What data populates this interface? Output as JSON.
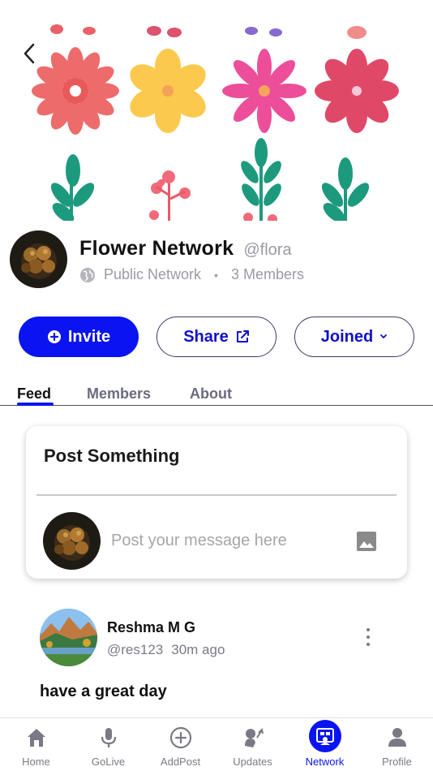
{
  "network": {
    "name": "Flower Network",
    "handle": "@flora",
    "visibility": "Public Network",
    "members_count": "3 Members"
  },
  "actions": {
    "invite_label": "Invite",
    "share_label": "Share",
    "joined_label": "Joined"
  },
  "tabs": [
    {
      "label": "Feed",
      "active": true
    },
    {
      "label": "Members",
      "active": false
    },
    {
      "label": "About",
      "active": false
    }
  ],
  "composer": {
    "title": "Post Something",
    "placeholder": "Post your message here"
  },
  "post": {
    "author": "Reshma M G",
    "handle": "@res123",
    "time": "30m ago",
    "text": "have a great day"
  },
  "bottom_nav": [
    {
      "label": "Home",
      "icon": "home-icon",
      "active": false
    },
    {
      "label": "GoLive",
      "icon": "microphone-icon",
      "active": false
    },
    {
      "label": "AddPost",
      "icon": "plus-circle-icon",
      "active": false
    },
    {
      "label": "Updates",
      "icon": "updates-icon",
      "active": false
    },
    {
      "label": "Network",
      "icon": "network-icon",
      "active": true
    },
    {
      "label": "Profile",
      "icon": "person-icon",
      "active": false
    }
  ],
  "colors": {
    "accent": "#0a14f0",
    "muted_text": "#9a9aa6",
    "border": "#3b3b6a"
  }
}
